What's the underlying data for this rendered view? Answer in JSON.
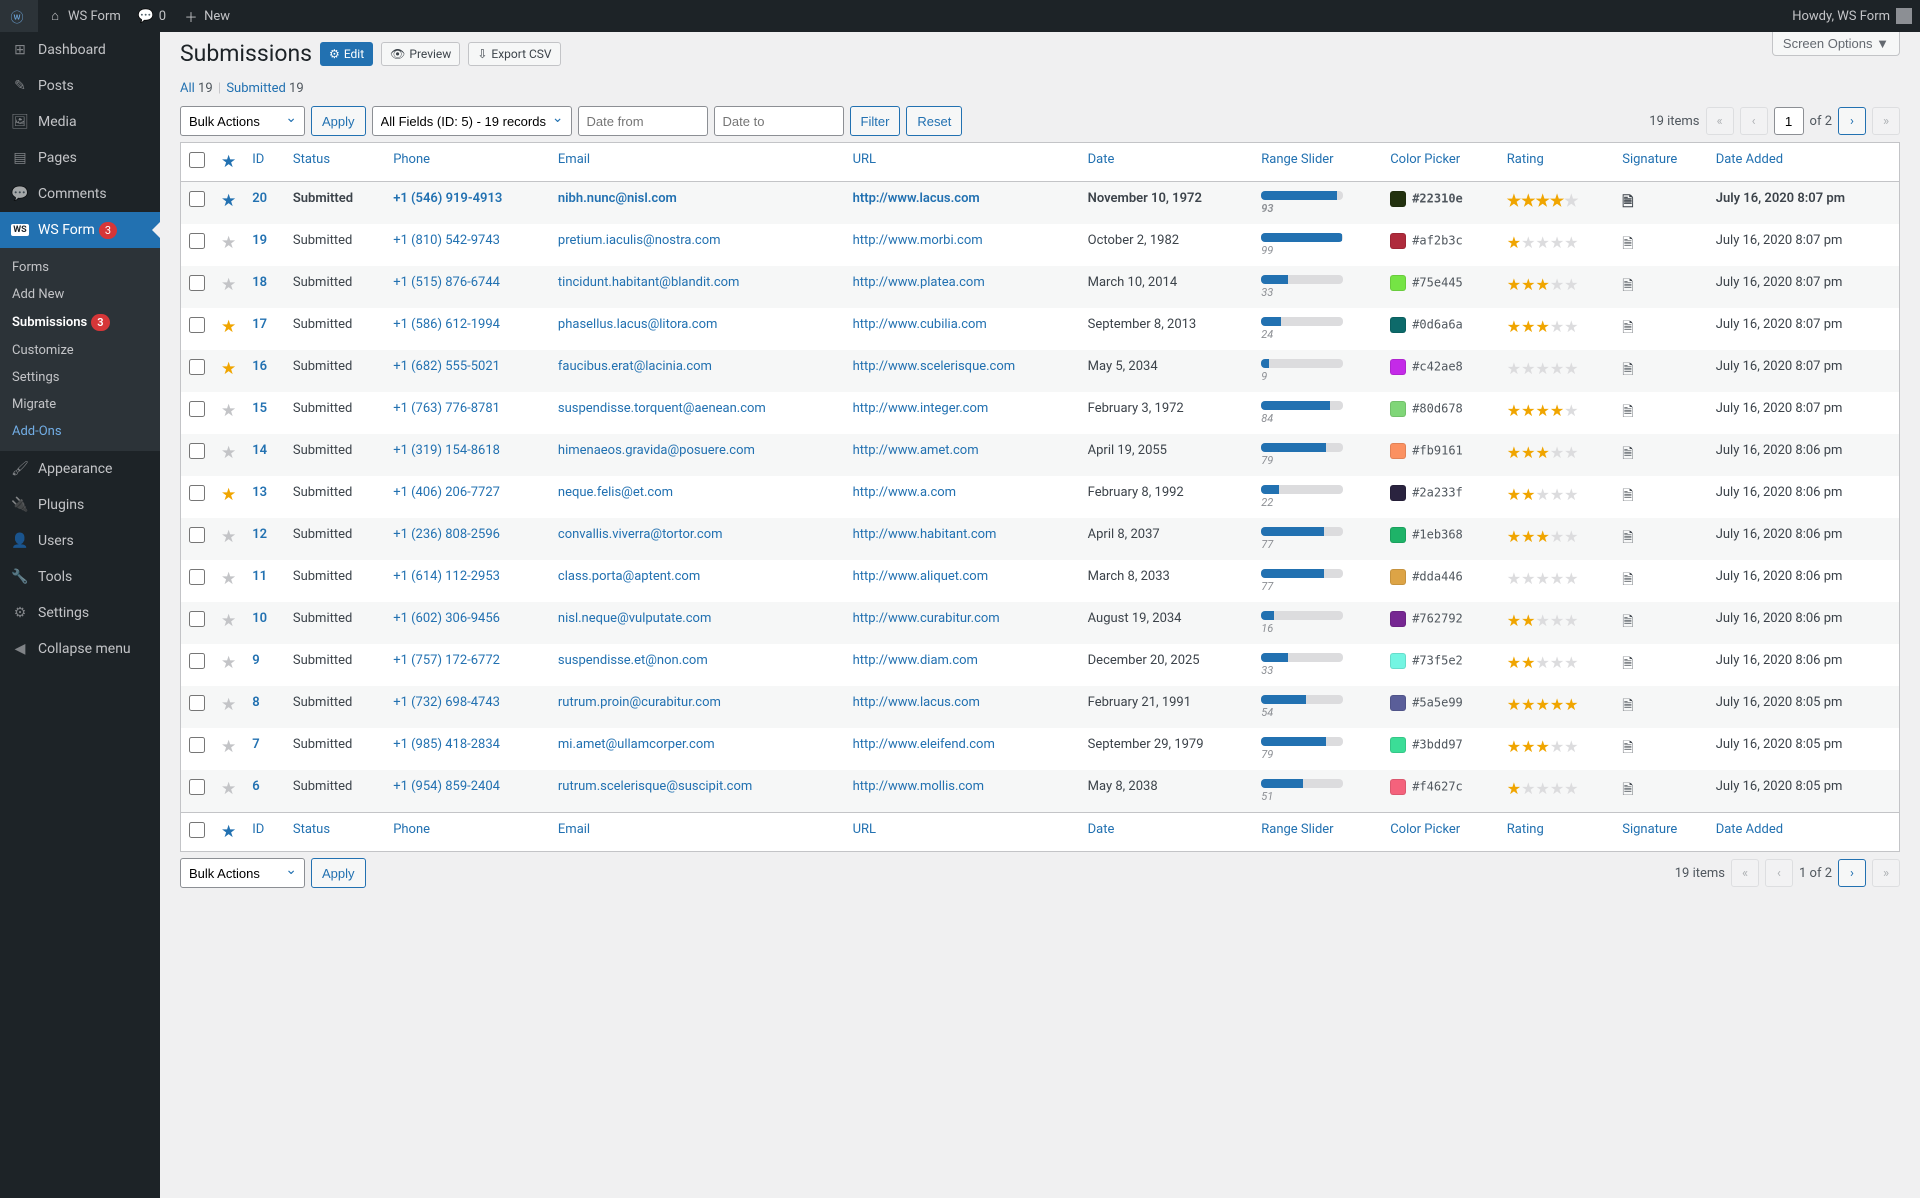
{
  "admin_bar": {
    "site": "WS Form",
    "comments": "0",
    "new": "New",
    "howdy": "Howdy, WS Form"
  },
  "sidebar": {
    "items": [
      {
        "icon": "dashboard",
        "label": "Dashboard"
      },
      {
        "icon": "posts",
        "label": "Posts"
      },
      {
        "icon": "media",
        "label": "Media"
      },
      {
        "icon": "pages",
        "label": "Pages"
      },
      {
        "icon": "comments",
        "label": "Comments"
      },
      {
        "icon": "wsf",
        "label": "WS Form",
        "badge": "3",
        "current": true
      },
      {
        "icon": "appearance",
        "label": "Appearance"
      },
      {
        "icon": "plugins",
        "label": "Plugins"
      },
      {
        "icon": "users",
        "label": "Users"
      },
      {
        "icon": "tools",
        "label": "Tools"
      },
      {
        "icon": "settings",
        "label": "Settings"
      },
      {
        "icon": "collapse",
        "label": "Collapse menu"
      }
    ],
    "submenu": [
      {
        "label": "Forms"
      },
      {
        "label": "Add New"
      },
      {
        "label": "Submissions",
        "badge": "3",
        "current": true
      },
      {
        "label": "Customize"
      },
      {
        "label": "Settings"
      },
      {
        "label": "Migrate"
      },
      {
        "label": "Add-Ons",
        "addon": true
      }
    ]
  },
  "screen_options": "Screen Options ▼",
  "header": {
    "title": "Submissions",
    "edit": "Edit",
    "preview": "Preview",
    "export": "Export CSV"
  },
  "subsubsub": {
    "all": "All",
    "all_count": "19",
    "sep": "|",
    "submitted": "Submitted",
    "submitted_count": "19"
  },
  "filters": {
    "bulk_actions": "Bulk Actions",
    "apply": "Apply",
    "field_sel": "All Fields (ID: 5) - 19 records",
    "date_from_ph": "Date from",
    "date_to_ph": "Date to",
    "filter": "Filter",
    "reset": "Reset"
  },
  "pagination": {
    "items": "19 items",
    "of": "of 2",
    "current": "1",
    "text": "1 of 2"
  },
  "columns": [
    "ID",
    "Status",
    "Phone",
    "Email",
    "URL",
    "Date",
    "Range Slider",
    "Color Picker",
    "Rating",
    "Signature",
    "Date Added"
  ],
  "rows": [
    {
      "star": "blue",
      "id": "20",
      "status": "Submitted",
      "phone": "+1 (546) 919-4913",
      "email": "nibh.nunc@nisl.com",
      "url": "http://www.lacus.com",
      "date": "November 10, 1972",
      "range": 93,
      "color": "#22310e",
      "rating": 4,
      "added": "July 16, 2020 8:07 pm",
      "bold": true
    },
    {
      "star": "off",
      "id": "19",
      "status": "Submitted",
      "phone": "+1 (810) 542-9743",
      "email": "pretium.iaculis@nostra.com",
      "url": "http://www.morbi.com",
      "date": "October 2, 1982",
      "range": 99,
      "color": "#af2b3c",
      "rating": 1,
      "added": "July 16, 2020 8:07 pm"
    },
    {
      "star": "off",
      "id": "18",
      "status": "Submitted",
      "phone": "+1 (515) 876-6744",
      "email": "tincidunt.habitant@blandit.com",
      "url": "http://www.platea.com",
      "date": "March 10, 2014",
      "range": 33,
      "color": "#75e445",
      "rating": 3,
      "added": "July 16, 2020 8:07 pm"
    },
    {
      "star": "on",
      "id": "17",
      "status": "Submitted",
      "phone": "+1 (586) 612-1994",
      "email": "phasellus.lacus@litora.com",
      "url": "http://www.cubilia.com",
      "date": "September 8, 2013",
      "range": 24,
      "color": "#0d6a6a",
      "rating": 3,
      "added": "July 16, 2020 8:07 pm"
    },
    {
      "star": "on",
      "id": "16",
      "status": "Submitted",
      "phone": "+1 (682) 555-5021",
      "email": "faucibus.erat@lacinia.com",
      "url": "http://www.scelerisque.com",
      "date": "May 5, 2034",
      "range": 9,
      "color": "#c42ae8",
      "rating": 0,
      "added": "July 16, 2020 8:07 pm"
    },
    {
      "star": "off",
      "id": "15",
      "status": "Submitted",
      "phone": "+1 (763) 776-8781",
      "email": "suspendisse.torquent@aenean.com",
      "url": "http://www.integer.com",
      "date": "February 3, 1972",
      "range": 84,
      "color": "#80d678",
      "rating": 4,
      "added": "July 16, 2020 8:07 pm"
    },
    {
      "star": "off",
      "id": "14",
      "status": "Submitted",
      "phone": "+1 (319) 154-8618",
      "email": "himenaeos.gravida@posuere.com",
      "url": "http://www.amet.com",
      "date": "April 19, 2055",
      "range": 79,
      "color": "#fb9161",
      "rating": 3,
      "added": "July 16, 2020 8:06 pm"
    },
    {
      "star": "on",
      "id": "13",
      "status": "Submitted",
      "phone": "+1 (406) 206-7727",
      "email": "neque.felis@et.com",
      "url": "http://www.a.com",
      "date": "February 8, 1992",
      "range": 22,
      "color": "#2a233f",
      "rating": 2,
      "added": "July 16, 2020 8:06 pm"
    },
    {
      "star": "off",
      "id": "12",
      "status": "Submitted",
      "phone": "+1 (236) 808-2596",
      "email": "convallis.viverra@tortor.com",
      "url": "http://www.habitant.com",
      "date": "April 8, 2037",
      "range": 77,
      "color": "#1eb368",
      "rating": 3,
      "added": "July 16, 2020 8:06 pm"
    },
    {
      "star": "off",
      "id": "11",
      "status": "Submitted",
      "phone": "+1 (614) 112-2953",
      "email": "class.porta@aptent.com",
      "url": "http://www.aliquet.com",
      "date": "March 8, 2033",
      "range": 77,
      "color": "#dda446",
      "rating": 0,
      "added": "July 16, 2020 8:06 pm"
    },
    {
      "star": "off",
      "id": "10",
      "status": "Submitted",
      "phone": "+1 (602) 306-9456",
      "email": "nisl.neque@vulputate.com",
      "url": "http://www.curabitur.com",
      "date": "August 19, 2034",
      "range": 16,
      "color": "#762792",
      "rating": 2,
      "added": "July 16, 2020 8:06 pm"
    },
    {
      "star": "off",
      "id": "9",
      "status": "Submitted",
      "phone": "+1 (757) 172-6772",
      "email": "suspendisse.et@non.com",
      "url": "http://www.diam.com",
      "date": "December 20, 2025",
      "range": 33,
      "color": "#73f5e2",
      "rating": 2,
      "added": "July 16, 2020 8:06 pm"
    },
    {
      "star": "off",
      "id": "8",
      "status": "Submitted",
      "phone": "+1 (732) 698-4743",
      "email": "rutrum.proin@curabitur.com",
      "url": "http://www.lacus.com",
      "date": "February 21, 1991",
      "range": 54,
      "color": "#5a5e99",
      "rating": 5,
      "added": "July 16, 2020 8:05 pm"
    },
    {
      "star": "off",
      "id": "7",
      "status": "Submitted",
      "phone": "+1 (985) 418-2834",
      "email": "mi.amet@ullamcorper.com",
      "url": "http://www.eleifend.com",
      "date": "September 29, 1979",
      "range": 79,
      "color": "#3bdd97",
      "rating": 3,
      "added": "July 16, 2020 8:05 pm"
    },
    {
      "star": "off",
      "id": "6",
      "status": "Submitted",
      "phone": "+1 (954) 859-2404",
      "email": "rutrum.scelerisque@suscipit.com",
      "url": "http://www.mollis.com",
      "date": "May 8, 2038",
      "range": 51,
      "color": "#f4627c",
      "rating": 1,
      "added": "July 16, 2020 8:05 pm"
    }
  ],
  "bottom": {
    "items": "19 items"
  }
}
